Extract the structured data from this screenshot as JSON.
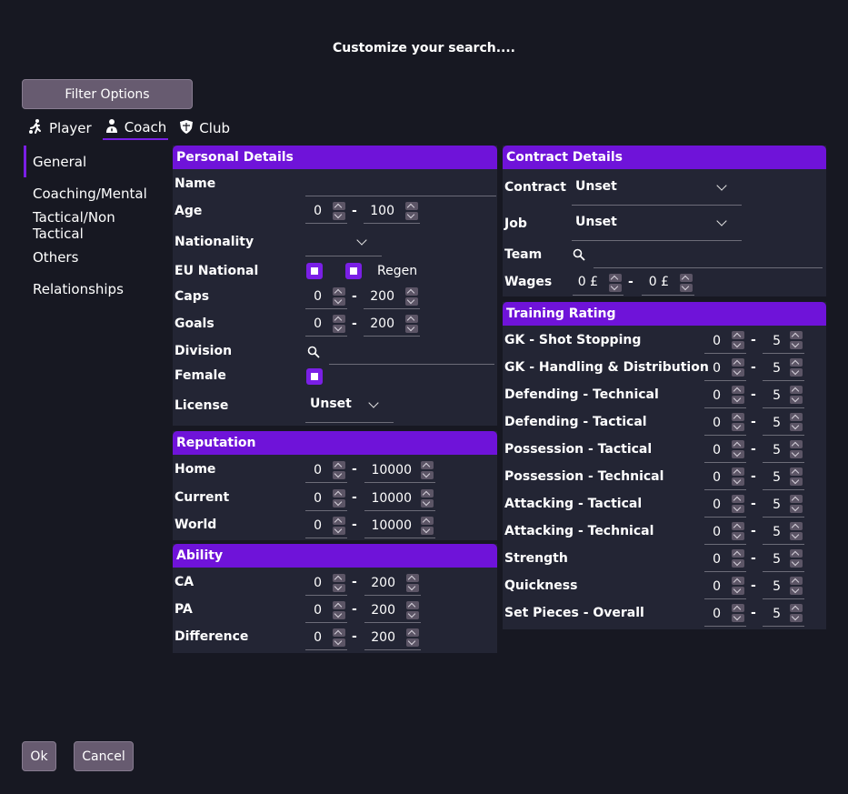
{
  "title": "Customize your search....",
  "filter_button": "Filter Options",
  "tabs": [
    {
      "label": "Player",
      "icon": "player-icon"
    },
    {
      "label": "Coach",
      "icon": "coach-icon"
    },
    {
      "label": "Club",
      "icon": "shield-icon"
    }
  ],
  "nav": [
    "General",
    "Coaching/Mental",
    "Tactical/Non Tactical",
    "Others",
    "Relationships"
  ],
  "personal": {
    "header": "Personal Details",
    "name": "Name",
    "age": {
      "label": "Age",
      "min": "0",
      "max": "100"
    },
    "nationality": "Nationality",
    "eu": "EU National",
    "regen": "Regen",
    "caps": {
      "label": "Caps",
      "min": "0",
      "max": "200"
    },
    "goals": {
      "label": "Goals",
      "min": "0",
      "max": "200"
    },
    "division": "Division",
    "female": "Female",
    "license": {
      "label": "License",
      "value": "Unset"
    }
  },
  "reputation": {
    "header": "Reputation",
    "rows": [
      {
        "label": "Home",
        "min": "0",
        "max": "10000"
      },
      {
        "label": "Current",
        "min": "0",
        "max": "10000"
      },
      {
        "label": "World",
        "min": "0",
        "max": "10000"
      }
    ]
  },
  "ability": {
    "header": "Ability",
    "rows": [
      {
        "label": "CA",
        "min": "0",
        "max": "200"
      },
      {
        "label": "PA",
        "min": "0",
        "max": "200"
      },
      {
        "label": "Difference",
        "min": "0",
        "max": "200"
      }
    ]
  },
  "contract": {
    "header": "Contract Details",
    "contract": {
      "label": "Contract",
      "value": "Unset"
    },
    "job": {
      "label": "Job",
      "value": "Unset"
    },
    "team": "Team",
    "wages": {
      "label": "Wages",
      "min": "0 £",
      "max": "0 £"
    }
  },
  "training": {
    "header": "Training Rating",
    "rows": [
      {
        "label": "GK - Shot Stopping",
        "min": "0",
        "max": "5"
      },
      {
        "label": "GK - Handling & Distribution",
        "min": "0",
        "max": "5"
      },
      {
        "label": "Defending - Technical",
        "min": "0",
        "max": "5"
      },
      {
        "label": "Defending - Tactical",
        "min": "0",
        "max": "5"
      },
      {
        "label": "Possession - Tactical",
        "min": "0",
        "max": "5"
      },
      {
        "label": "Possession - Technical",
        "min": "0",
        "max": "5"
      },
      {
        "label": "Attacking - Tactical",
        "min": "0",
        "max": "5"
      },
      {
        "label": "Attacking - Technical",
        "min": "0",
        "max": "5"
      },
      {
        "label": "Strength",
        "min": "0",
        "max": "5"
      },
      {
        "label": "Quickness",
        "min": "0",
        "max": "5"
      },
      {
        "label": "Set Pieces - Overall",
        "min": "0",
        "max": "5"
      }
    ]
  },
  "ok": "Ok",
  "cancel": "Cancel",
  "colors": {
    "accent": "#7a1fe6",
    "header": "#6f13d9",
    "panel": "#232534",
    "background": "#171822",
    "button": "#675b70"
  }
}
